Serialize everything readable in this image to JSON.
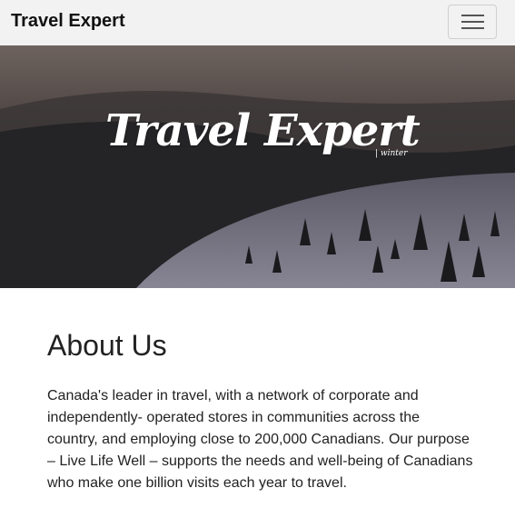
{
  "navbar": {
    "brand": "Travel Expert",
    "toggle_icon": "hamburger-menu-icon"
  },
  "hero": {
    "title": "Travel Expert",
    "subtitle": "| winter"
  },
  "about": {
    "heading": "About Us",
    "body": "Canada's leader in travel, with a network of corporate and independently- operated stores in communities across the country, and employing close to 200,000 Canadians. Our purpose – Live Life Well – supports the needs and well-being of Canadians who make one billion visits each year to travel."
  },
  "colors": {
    "navbar_bg": "#f2f2f2",
    "text": "#222222",
    "hero_text": "#ffffff"
  }
}
